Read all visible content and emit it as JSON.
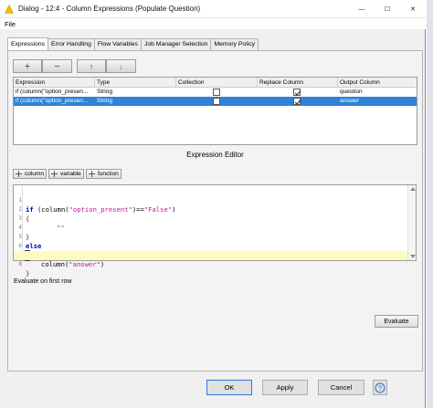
{
  "window": {
    "title": "Dialog - 12:4 - Column Expressions (Populate Question)",
    "controls": {
      "minimize": "—",
      "maximize": "☐",
      "close": "✕"
    }
  },
  "menu": {
    "file": "File"
  },
  "tabs": [
    {
      "label": "Expressions",
      "active": true
    },
    {
      "label": "Error Handling"
    },
    {
      "label": "Flow Variables"
    },
    {
      "label": "Job Manager Selection"
    },
    {
      "label": "Memory Policy"
    }
  ],
  "toolbar": {
    "add": "+",
    "remove": "−",
    "up": "↑",
    "down": "↓"
  },
  "table": {
    "columns": [
      "Expression",
      "Type",
      "Collection",
      "Replace Column",
      "Output Column"
    ],
    "rows": [
      {
        "expression": "if (column(\"option_presen...",
        "type": "String",
        "collection": false,
        "replace": true,
        "output": "question",
        "selected": false
      },
      {
        "expression": "if (column(\"option_presen...",
        "type": "String",
        "collection": false,
        "replace": true,
        "output": "answer",
        "selected": true
      }
    ]
  },
  "editor": {
    "title": "Expression Editor",
    "buttons": {
      "column": "column",
      "variable": "variable",
      "function": "function"
    },
    "line_numbers": [
      "1",
      "2",
      "3",
      "4",
      "5",
      "6",
      "7",
      "8"
    ],
    "code": {
      "l1_kw": "if",
      "l1_a": " (column(",
      "l1_s1": "\"option_present\"",
      "l1_b": ")==",
      "l1_s2": "\"False\"",
      "l1_c": ")",
      "l2": "{",
      "l3": "\"\"",
      "l4": "}",
      "l5": "else",
      "l6": "{",
      "l7_a": "column(",
      "l7_s": "\"answer\"",
      "l7_b": ")",
      "l8": "}"
    }
  },
  "evaluate": {
    "label": "Evaluate on first row",
    "button": "Evaluate"
  },
  "footer": {
    "ok": "OK",
    "apply": "Apply",
    "cancel": "Cancel",
    "help": "?"
  },
  "colors": {
    "selection": "#2f83d6",
    "current_line": "#fdfcc0",
    "keyword": "#0000c8",
    "string": "#c0198f"
  }
}
